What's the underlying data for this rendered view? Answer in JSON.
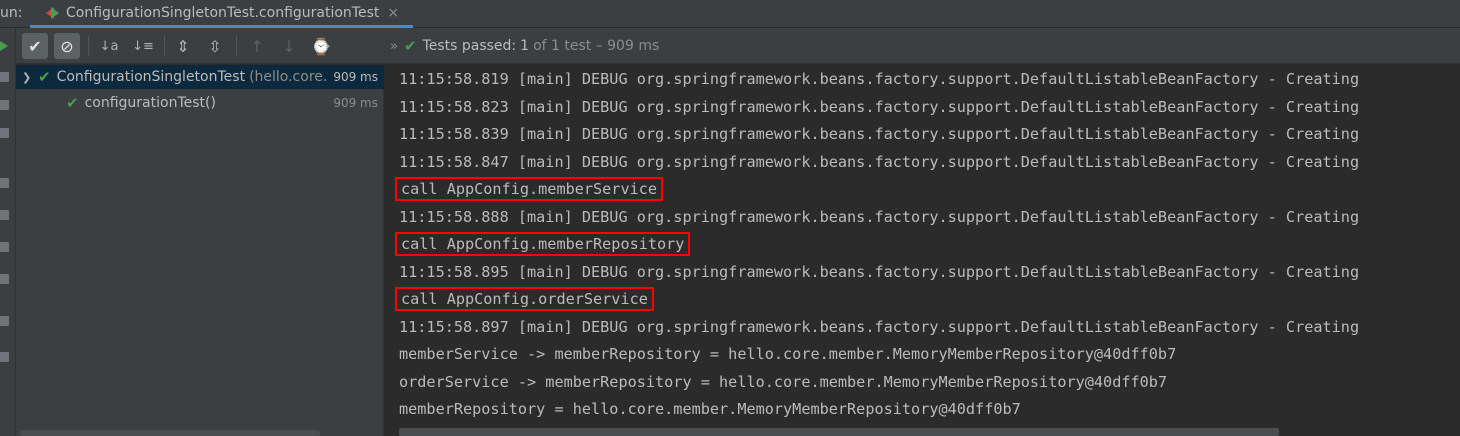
{
  "run_panel": {
    "run_label": "un:",
    "tab": {
      "label": "ConfigurationSingletonTest.configurationTest",
      "close_glyph": "×"
    }
  },
  "toolbar": {
    "buttons": [
      {
        "name": "show-passed-icon",
        "glyph": "✔"
      },
      {
        "name": "show-ignored-icon",
        "glyph": "⊘"
      },
      {
        "name": "sort-alphabetically-icon",
        "glyph": "↓a"
      },
      {
        "name": "sort-by-duration-icon",
        "glyph": "↓≡"
      },
      {
        "name": "expand-all-icon",
        "glyph": "⇕"
      },
      {
        "name": "collapse-all-icon",
        "glyph": "⇳"
      },
      {
        "name": "previous-failed-icon",
        "glyph": "↑"
      },
      {
        "name": "next-failed-icon",
        "glyph": "↓"
      },
      {
        "name": "test-history-icon",
        "glyph": "⌚"
      }
    ],
    "more_glyph": "»",
    "status": {
      "label": "Tests passed:",
      "passed": "1",
      "rest": "of 1 test – 909 ms"
    }
  },
  "tree": {
    "rows": [
      {
        "name": "ConfigurationSingletonTest",
        "pkg": "(hello.core.",
        "time": "909 ms",
        "expanded": true,
        "selected": true
      },
      {
        "name": "configurationTest()",
        "pkg": "",
        "time": "909 ms",
        "expanded": false,
        "selected": false
      }
    ]
  },
  "console": {
    "lines": [
      {
        "text": "11:15:58.819 [main] DEBUG org.springframework.beans.factory.support.DefaultListableBeanFactory - Creating",
        "highlight": false
      },
      {
        "text": "11:15:58.823 [main] DEBUG org.springframework.beans.factory.support.DefaultListableBeanFactory - Creating",
        "highlight": false
      },
      {
        "text": "11:15:58.839 [main] DEBUG org.springframework.beans.factory.support.DefaultListableBeanFactory - Creating",
        "highlight": false
      },
      {
        "text": "11:15:58.847 [main] DEBUG org.springframework.beans.factory.support.DefaultListableBeanFactory - Creating",
        "highlight": false
      },
      {
        "text": "call AppConfig.memberService",
        "highlight": true
      },
      {
        "text": "11:15:58.888 [main] DEBUG org.springframework.beans.factory.support.DefaultListableBeanFactory - Creating",
        "highlight": false
      },
      {
        "text": "call AppConfig.memberRepository",
        "highlight": true
      },
      {
        "text": "11:15:58.895 [main] DEBUG org.springframework.beans.factory.support.DefaultListableBeanFactory - Creating",
        "highlight": false
      },
      {
        "text": "call AppConfig.orderService",
        "highlight": true
      },
      {
        "text": "11:15:58.897 [main] DEBUG org.springframework.beans.factory.support.DefaultListableBeanFactory - Creating",
        "highlight": false
      },
      {
        "text": "memberService -> memberRepository = hello.core.member.MemoryMemberRepository@40dff0b7",
        "highlight": false
      },
      {
        "text": "orderService -> memberRepository = hello.core.member.MemoryMemberRepository@40dff0b7",
        "highlight": false
      },
      {
        "text": "memberRepository = hello.core.member.MemoryMemberRepository@40dff0b7",
        "highlight": false
      }
    ]
  },
  "colors": {
    "background": "#2b2b2b",
    "panel": "#3c3f41",
    "success_green": "#499c54",
    "highlight_box": "#ff0000",
    "selection": "#0d293e"
  }
}
